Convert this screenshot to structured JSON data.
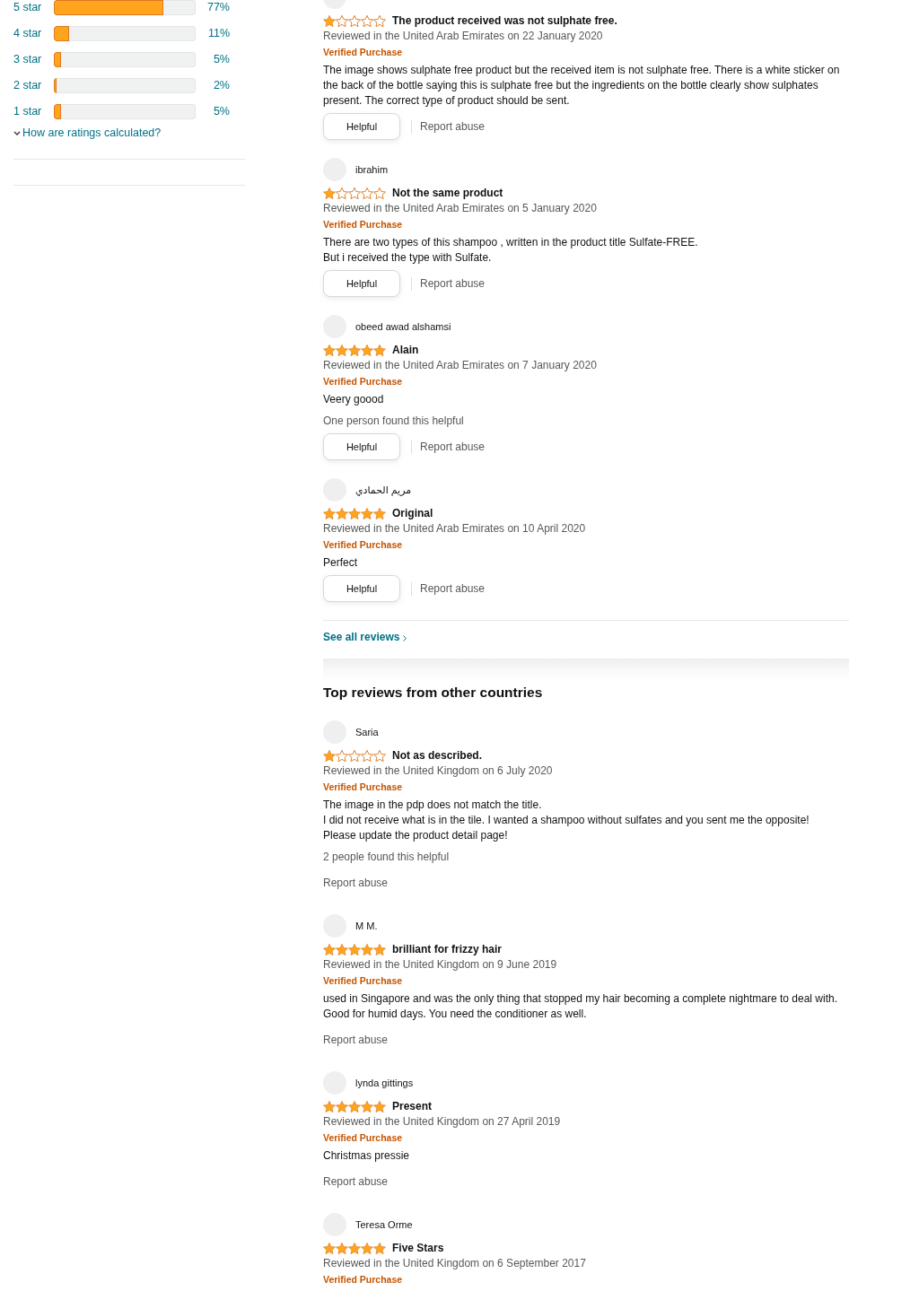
{
  "rating_breakdown": {
    "rows": [
      {
        "label": "5 star",
        "level": 0.77,
        "percent": "77%"
      },
      {
        "label": "4 star",
        "level": 0.11,
        "percent": "11%"
      },
      {
        "label": "3 star",
        "level": 0.05,
        "percent": "5%"
      },
      {
        "label": "2 star",
        "level": 0.02,
        "percent": "2%"
      },
      {
        "label": "1 star",
        "level": 0.05,
        "percent": "5%"
      }
    ],
    "help_link": "How are ratings calculated?"
  },
  "reviews": [
    {
      "stars": 1,
      "title": "The product received was not sulphate free.",
      "meta": "Reviewed in the United Arab Emirates on 22 January 2020",
      "verified": "Verified Purchase",
      "body": "The image shows sulphate free product but the received item is not sulphate free. There is a white sticker on the back of the bottle saying this is sulphate free but the ingredients on the bottle clearly show sulphates present. The correct type of product should be sent.",
      "helpful_button": "Helpful",
      "report_link": "Report abuse"
    },
    {
      "reviewer": "ibrahim",
      "stars": 1,
      "title": "Not the same product",
      "meta": "Reviewed in the United Arab Emirates on 5 January 2020",
      "verified": "Verified Purchase",
      "body": "There are two types of this shampoo , written in the product title Sulfate-FREE.\nBut i received the type with Sulfate.",
      "helpful_button": "Helpful",
      "report_link": "Report abuse"
    },
    {
      "reviewer": "obeed awad alshamsi",
      "stars": 5,
      "title": "Alain",
      "meta": "Reviewed in the United Arab Emirates on 7 January 2020",
      "verified": "Verified Purchase",
      "body": "Veery goood",
      "helpful_count": "One person found this helpful",
      "helpful_button": "Helpful",
      "report_link": "Report abuse"
    },
    {
      "reviewer": "مريم الحمادي",
      "stars": 5,
      "title": "Original",
      "meta": "Reviewed in the United Arab Emirates on 10 April 2020",
      "verified": "Verified Purchase",
      "body": "Perfect",
      "helpful_button": "Helpful",
      "report_link": "Report abuse"
    }
  ],
  "see_all_link": "See all reviews",
  "other_countries": {
    "heading": "Top reviews from other countries",
    "reviews": [
      {
        "reviewer": "Saria",
        "stars": 1,
        "title": "Not as described.",
        "meta": "Reviewed in the United Kingdom on 6 July 2020",
        "verified": "Verified Purchase",
        "body": "The image in the pdp does not match the title.\nI did not receive what is in the tile. I wanted a shampoo without sulfates and you sent me the opposite!\nPlease update the product detail page!",
        "helpful_count": "2 people found this helpful",
        "report_link": "Report abuse"
      },
      {
        "reviewer": "M M.",
        "stars": 5,
        "title": "brilliant for frizzy hair",
        "meta": "Reviewed in the United Kingdom on 9 June 2019",
        "verified": "Verified Purchase",
        "body": "used in Singapore and was the only thing that stopped my hair becoming a complete nightmare to deal with. Good for humid days. You need the conditioner as well.",
        "report_link": "Report abuse"
      },
      {
        "reviewer": "lynda gittings",
        "stars": 5,
        "title": "Present",
        "meta": "Reviewed in the United Kingdom on 27 April 2019",
        "verified": "Verified Purchase",
        "body": "Christmas pressie",
        "report_link": "Report abuse"
      },
      {
        "reviewer": "Teresa Orme",
        "stars": 5,
        "title": "Five Stars",
        "meta": "Reviewed in the United Kingdom on 6 September 2017",
        "verified": "Verified Purchase"
      }
    ]
  }
}
